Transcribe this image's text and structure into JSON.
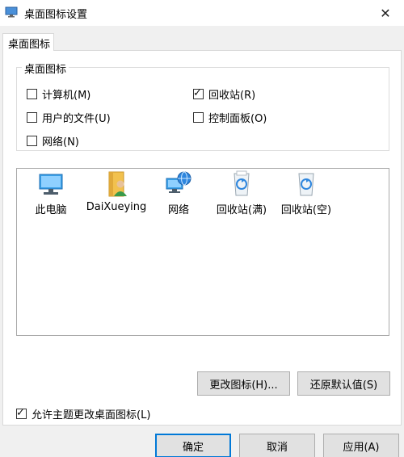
{
  "window": {
    "title": "桌面图标设置",
    "close_glyph": "✕"
  },
  "tab": {
    "label": "桌面图标"
  },
  "group": {
    "legend": "桌面图标",
    "checkboxes": [
      {
        "label": "计算机(M)",
        "checked": false
      },
      {
        "label": "回收站(R)",
        "checked": true
      },
      {
        "label": "用户的文件(U)",
        "checked": false
      },
      {
        "label": "控制面板(O)",
        "checked": false
      },
      {
        "label": "网络(N)",
        "checked": false
      }
    ]
  },
  "icons": [
    {
      "label": "此电脑",
      "icon": "this-pc-icon"
    },
    {
      "label": "DaiXueying",
      "icon": "user-folder-icon"
    },
    {
      "label": "网络",
      "icon": "network-icon"
    },
    {
      "label": "回收站(满)",
      "icon": "recycle-bin-full-icon"
    },
    {
      "label": "回收站(空)",
      "icon": "recycle-bin-empty-icon"
    }
  ],
  "buttons": {
    "change_icon": "更改图标(H)...",
    "restore_default": "还原默认值(S)",
    "ok": "确定",
    "cancel": "取消",
    "apply": "应用(A)"
  },
  "allow_themes": {
    "label": "允许主题更改桌面图标(L)",
    "checked": true
  },
  "check_glyph": "✓",
  "colors": {
    "accent": "#0078d7",
    "folder": "#f2c14e",
    "monitor": "#3aa0e8"
  }
}
